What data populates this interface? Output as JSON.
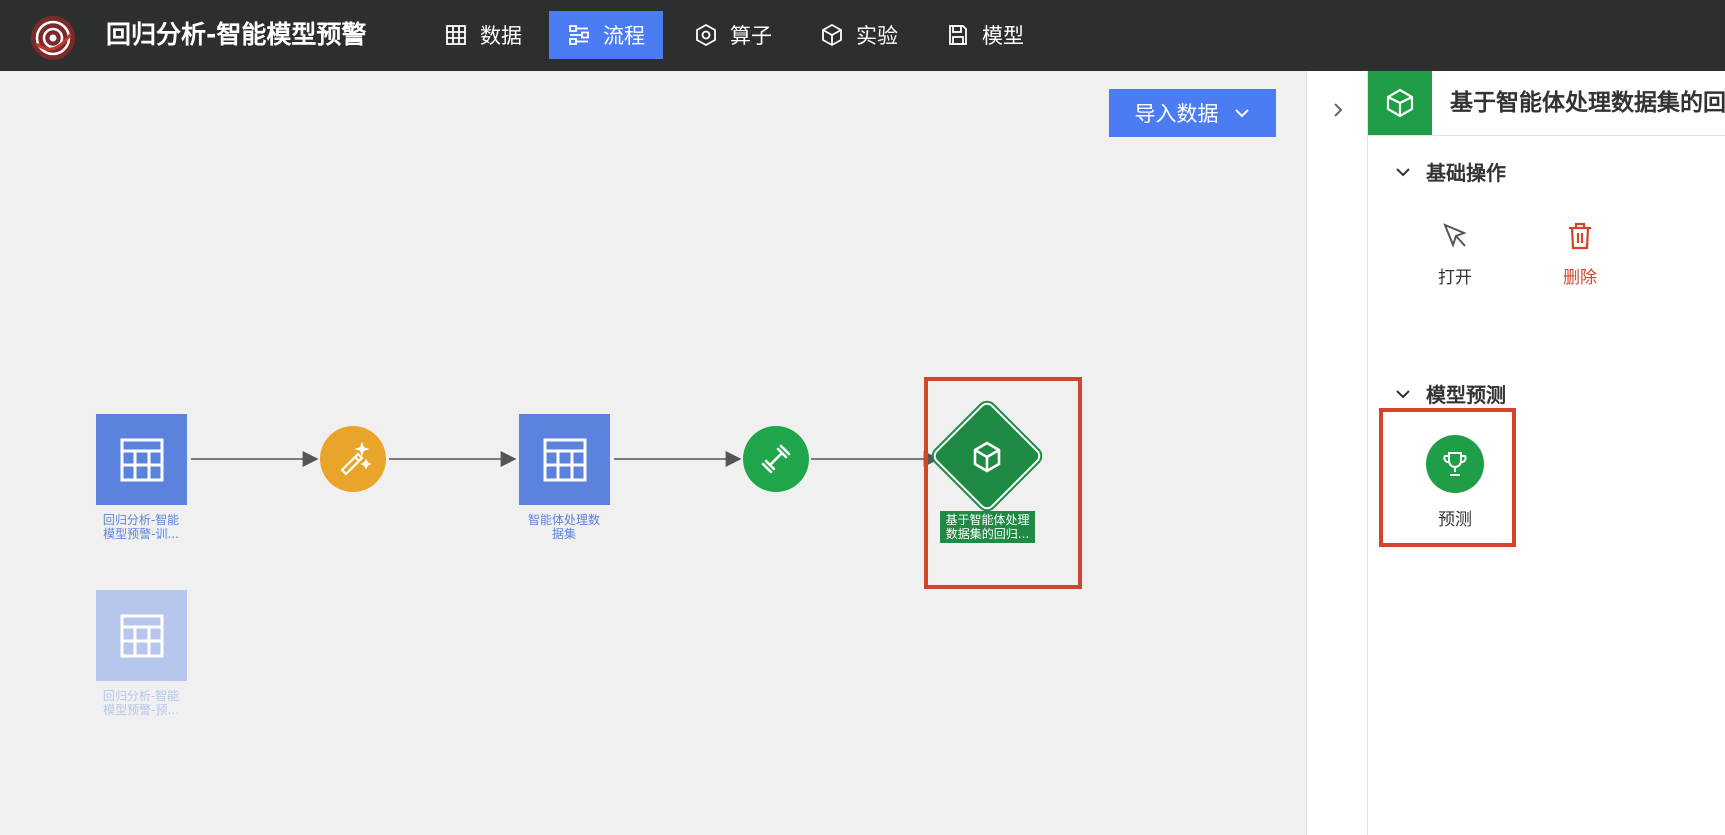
{
  "app": {
    "title": "回归分析-智能模型预警"
  },
  "nav": [
    {
      "label": "数据",
      "icon": "table-icon"
    },
    {
      "label": "流程",
      "icon": "flow-icon"
    },
    {
      "label": "算子",
      "icon": "operator-icon"
    },
    {
      "label": "实验",
      "icon": "cube-icon"
    },
    {
      "label": "模型",
      "icon": "save-icon"
    }
  ],
  "nav_active": "流程",
  "canvas": {
    "import_button": "导入数据",
    "nodes": [
      {
        "label_line1": "回归分析-智能",
        "label_line2": "模型预警-训..."
      },
      {
        "label": ""
      },
      {
        "label_line1": "智能体处理数",
        "label_line2": "据集"
      },
      {
        "label": ""
      },
      {
        "label_line1": "基于智能体处理",
        "label_line2": "数据集的回归..."
      },
      {
        "label_line1": "回归分析-智能",
        "label_line2": "模型预警-预..."
      }
    ]
  },
  "panel": {
    "title": "基于智能体处理数据集的回",
    "sections": [
      {
        "title": "基础操作",
        "actions": [
          {
            "label": "打开"
          },
          {
            "label": "删除"
          }
        ]
      },
      {
        "title": "模型预测",
        "actions": [
          {
            "label": "预测"
          }
        ]
      }
    ]
  },
  "colors": {
    "topbar": "#2d2f2e",
    "accent": "#4c7cf3",
    "dataset_node": "#5b83dd",
    "transform_node": "#e9a52a",
    "train_node": "#1fa64a",
    "model_node": "#1f8a44",
    "highlight": "#d2452b",
    "delete": "#d2452b"
  }
}
